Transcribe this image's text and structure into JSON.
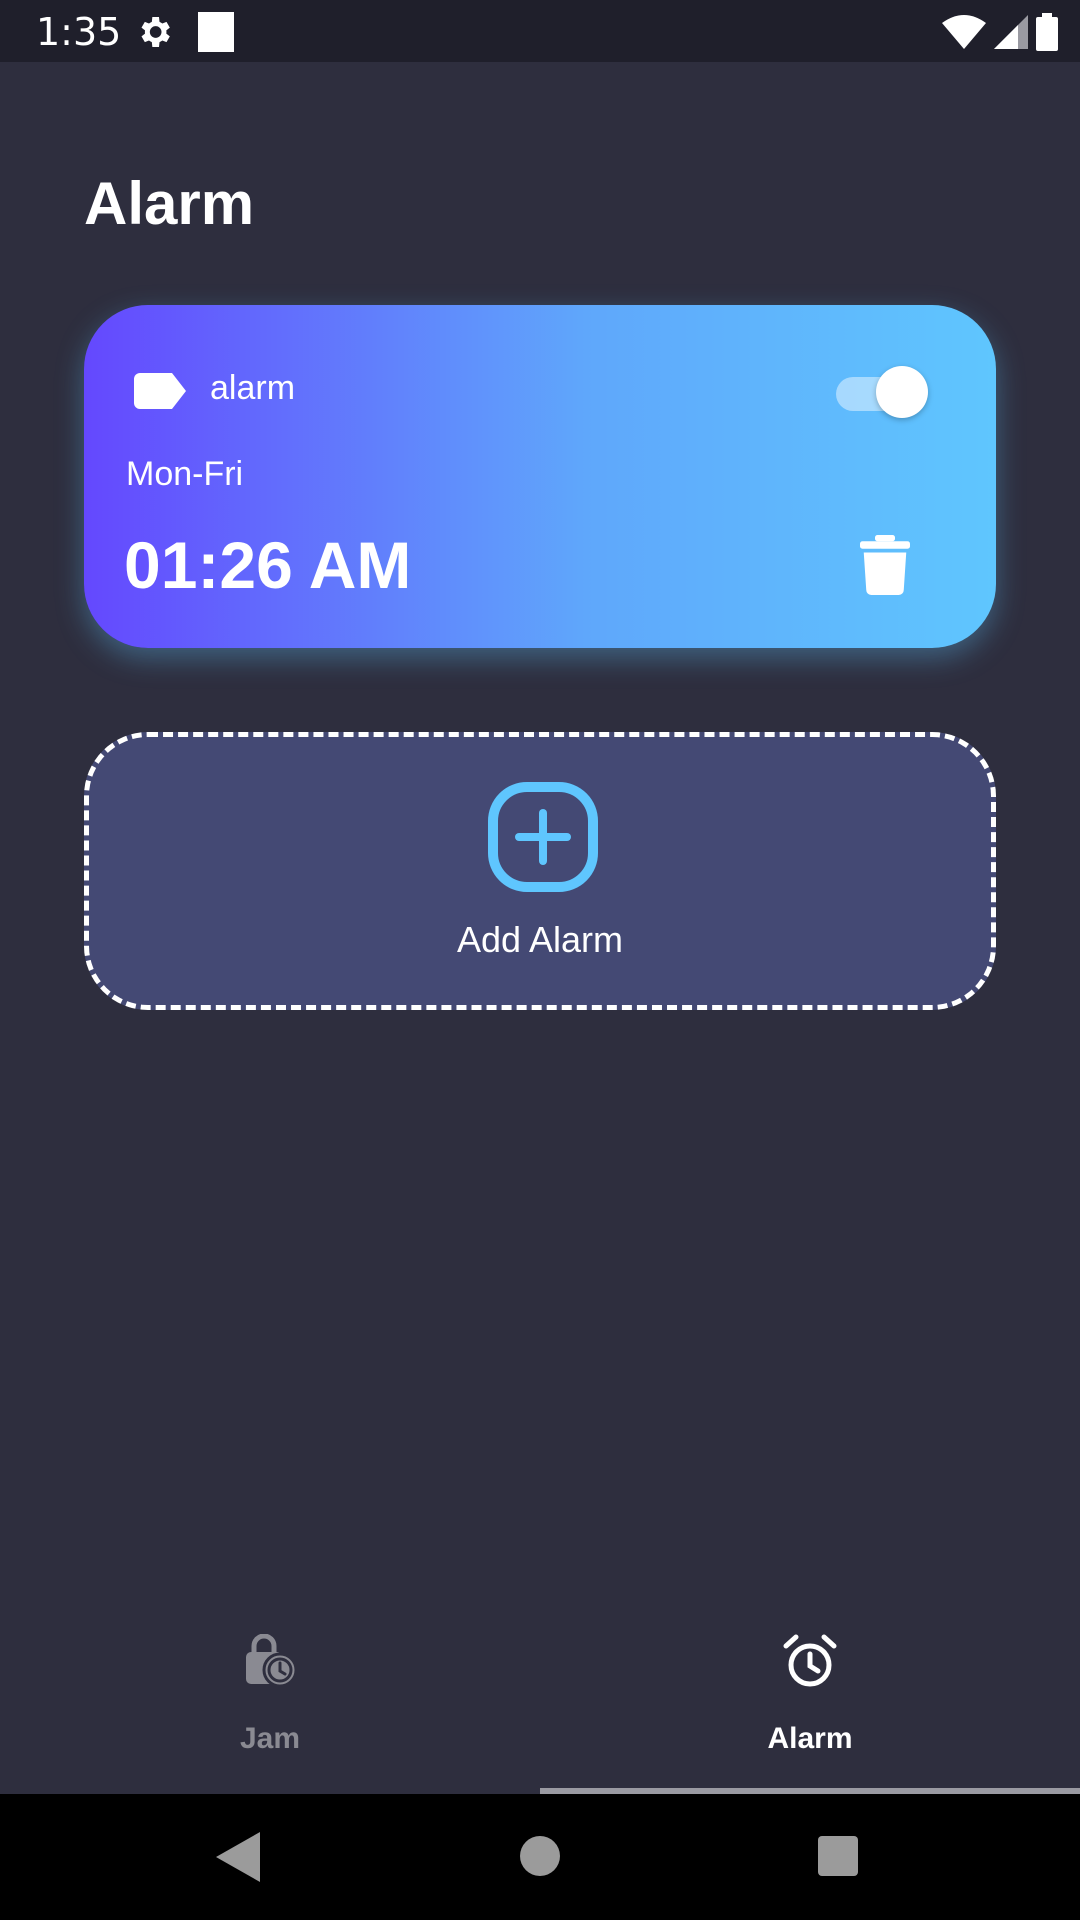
{
  "status_bar": {
    "time": "1:35",
    "icons": [
      "gear-icon",
      "notification-square-icon",
      "wifi-icon",
      "signal-icon",
      "battery-icon"
    ]
  },
  "page": {
    "title": "Alarm"
  },
  "alarm_card": {
    "label": "alarm",
    "days": "Mon-Fri",
    "time": "01:26 AM",
    "enabled": true,
    "gradient": [
      "#6448fe",
      "#5fc6fe"
    ]
  },
  "add_alarm": {
    "label": "Add Alarm",
    "accent": "#5fc6fe"
  },
  "bottom_nav": {
    "items": [
      {
        "label": "Jam",
        "icon": "lock-clock-icon",
        "active": false
      },
      {
        "label": "Alarm",
        "icon": "alarm-clock-icon",
        "active": true
      }
    ]
  },
  "system_nav": {
    "icons": [
      "back-icon",
      "home-icon",
      "recents-icon"
    ]
  },
  "colors": {
    "background": "#2e2e3e",
    "add_card_background": "#444974",
    "status_bar": "#1f1f2b"
  }
}
